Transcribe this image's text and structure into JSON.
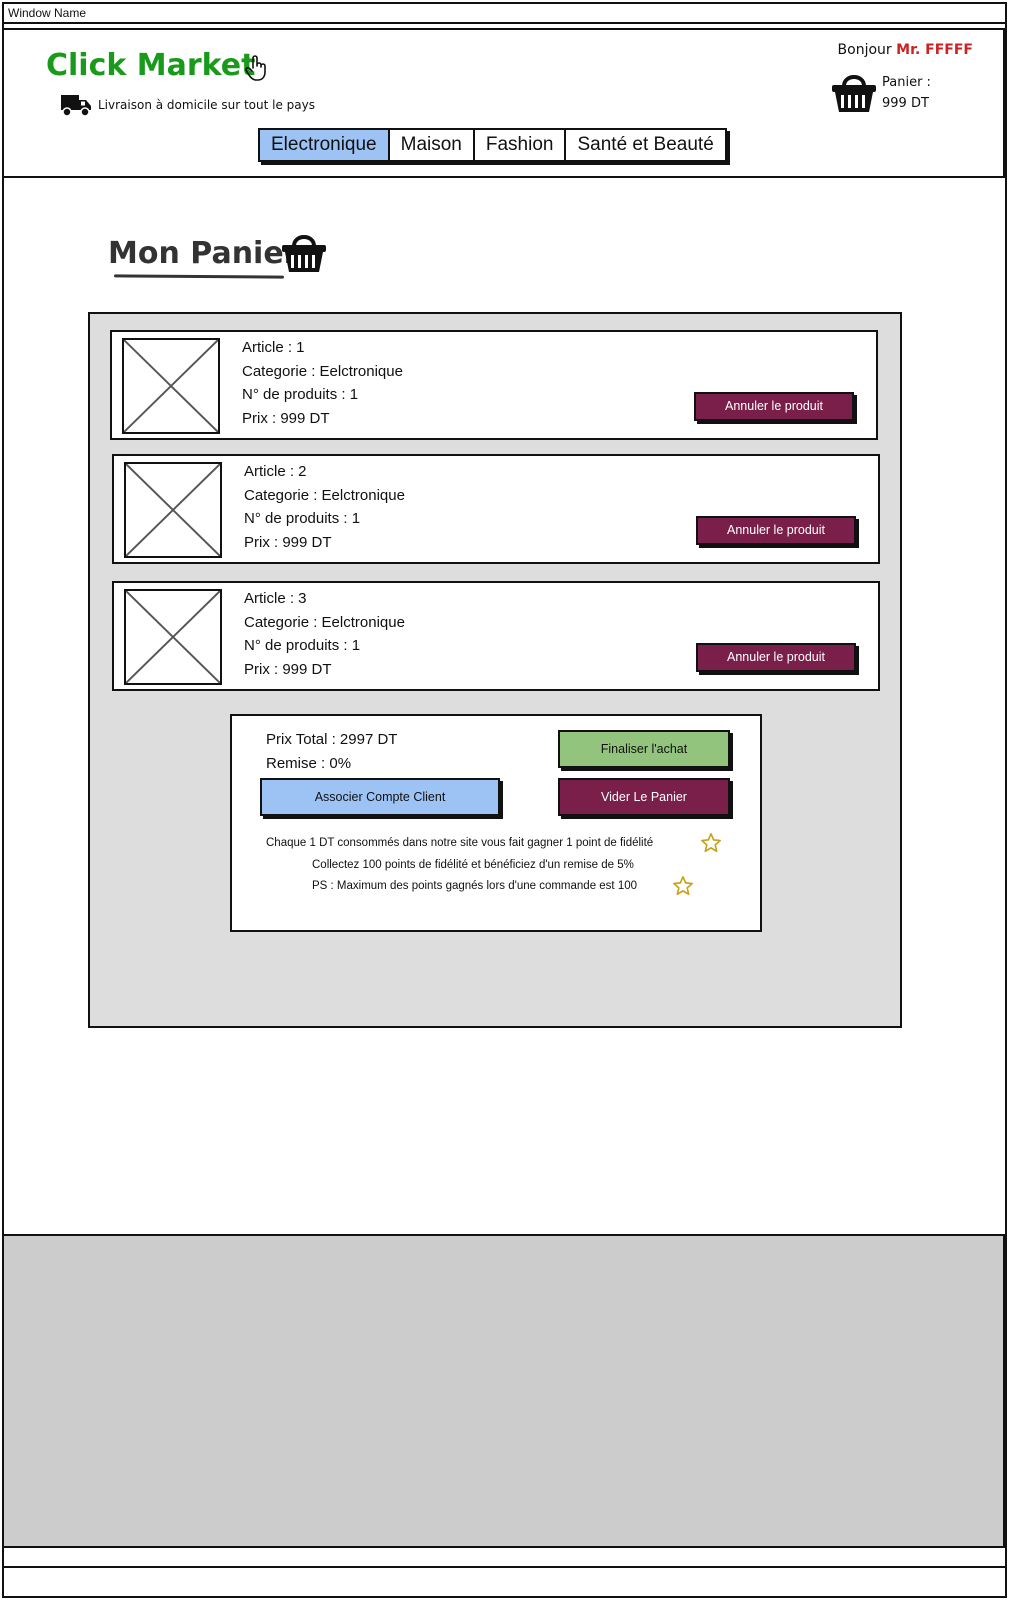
{
  "window": {
    "title": "Window Name"
  },
  "header": {
    "logo": "Click Market",
    "delivery_text": "Livraison à domicile sur tout le pays",
    "greeting": "Bonjour",
    "user_name": "Mr. FFFFF",
    "cart_label": "Panier :",
    "cart_amount": "999 DT"
  },
  "nav": {
    "tabs": [
      {
        "label": "Electronique",
        "active": true
      },
      {
        "label": "Maison",
        "active": false
      },
      {
        "label": "Fashion",
        "active": false
      },
      {
        "label": "Santé et Beauté",
        "active": false
      }
    ]
  },
  "page": {
    "title": "Mon Panier"
  },
  "items": [
    {
      "article": "Article : 1",
      "category": "Categorie : Eelctronique",
      "count": "N° de produits : 1",
      "price": "Prix : 999 DT",
      "button": "Annuler le produit"
    },
    {
      "article": "Article : 2",
      "category": "Categorie : Eelctronique",
      "count": "N° de produits : 1",
      "price": "Prix : 999 DT",
      "button": "Annuler le produit"
    },
    {
      "article": "Article : 3",
      "category": "Categorie : Eelctronique",
      "count": "N° de produits : 1",
      "price": "Prix : 999 DT",
      "button": "Annuler le produit"
    }
  ],
  "summary": {
    "total": "Prix Total : 2997 DT",
    "discount": "Remise : 0%",
    "finish_button": "Finaliser l'achat",
    "clear_button": "Vider Le Panier",
    "associate_button": "Associer Compte Client",
    "loyalty_line1": "Chaque 1 DT consommés dans notre site vous fait gagner 1 point de fidélité",
    "loyalty_line2": "Collectez 100 points de fidélité et bénéficiez d'un remise de 5%",
    "loyalty_line3": "PS : Maximum des points gagnés lors d'une commande est 100"
  },
  "colors": {
    "logo": "#1a9a1a",
    "user_name": "#cc2222",
    "active_tab": "#9dc3f5",
    "danger_button": "#7a1f4a",
    "finish_button": "#93c47d",
    "star": "#c8a21a",
    "panel": "#dddddd",
    "footer": "#cccccc"
  },
  "icons": [
    "hand-pointer-icon",
    "truck-icon",
    "shopping-basket-icon",
    "image-placeholder-icon",
    "star-icon"
  ]
}
